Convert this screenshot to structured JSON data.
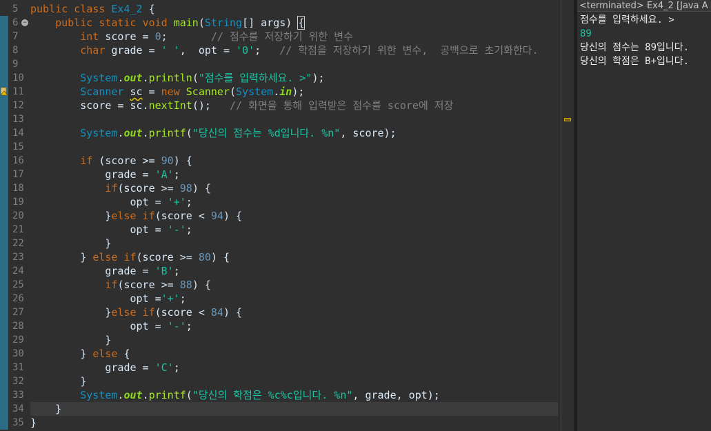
{
  "editor": {
    "lines": [
      {
        "n": "5",
        "segs": [
          [
            "kw",
            "public "
          ],
          [
            "kw",
            "class "
          ],
          [
            "cls",
            "Ex4_2"
          ],
          [
            "id",
            " {"
          ]
        ]
      },
      {
        "n": "6",
        "fold": true,
        "segs": [
          [
            "id",
            "    "
          ],
          [
            "kw",
            "public "
          ],
          [
            "kw",
            "static "
          ],
          [
            "kw",
            "void "
          ],
          [
            "mth",
            "main"
          ],
          [
            "id",
            "("
          ],
          [
            "cls",
            "String"
          ],
          [
            "id",
            "[] "
          ],
          [
            "id",
            "args) "
          ],
          [
            "brk",
            "{"
          ]
        ]
      },
      {
        "n": "7",
        "segs": [
          [
            "id",
            "        "
          ],
          [
            "kw",
            "int "
          ],
          [
            "id",
            "score = "
          ],
          [
            "num",
            "0"
          ],
          [
            "id",
            ";       "
          ],
          [
            "cmt",
            "// 점수를 저장하기 위한 변수"
          ]
        ]
      },
      {
        "n": "8",
        "segs": [
          [
            "id",
            "        "
          ],
          [
            "kw",
            "char "
          ],
          [
            "id",
            "grade = "
          ],
          [
            "str",
            "' '"
          ],
          [
            "id",
            ",  opt = "
          ],
          [
            "str",
            "'0'"
          ],
          [
            "id",
            ";   "
          ],
          [
            "cmt",
            "// 학점을 저장하기 위한 변수,  공백으로 초기화한다."
          ]
        ]
      },
      {
        "n": "9",
        "segs": []
      },
      {
        "n": "10",
        "segs": [
          [
            "id",
            "        "
          ],
          [
            "cls",
            "System"
          ],
          [
            "id",
            "."
          ],
          [
            "st-fld",
            "out"
          ],
          [
            "id",
            "."
          ],
          [
            "mth",
            "println"
          ],
          [
            "id",
            "("
          ],
          [
            "str",
            "\"점수를 입력하세요. >\""
          ],
          [
            "id",
            ");"
          ]
        ]
      },
      {
        "n": "11",
        "warn": true,
        "segs": [
          [
            "id",
            "        "
          ],
          [
            "cls",
            "Scanner "
          ],
          [
            "squig",
            "sc"
          ],
          [
            "id",
            " = "
          ],
          [
            "kw",
            "new "
          ],
          [
            "mth",
            "Scanner"
          ],
          [
            "id",
            "("
          ],
          [
            "cls",
            "System"
          ],
          [
            "id",
            "."
          ],
          [
            "st-fld",
            "in"
          ],
          [
            "id",
            ");"
          ]
        ]
      },
      {
        "n": "12",
        "segs": [
          [
            "id",
            "        "
          ],
          [
            "id",
            "score = sc."
          ],
          [
            "mth",
            "nextInt"
          ],
          [
            "id",
            "();   "
          ],
          [
            "cmt",
            "// 화면을 통해 입력받은 점수를 score에 저장"
          ]
        ]
      },
      {
        "n": "13",
        "segs": []
      },
      {
        "n": "14",
        "segs": [
          [
            "id",
            "        "
          ],
          [
            "cls",
            "System"
          ],
          [
            "id",
            "."
          ],
          [
            "st-fld",
            "out"
          ],
          [
            "id",
            "."
          ],
          [
            "mth",
            "printf"
          ],
          [
            "id",
            "("
          ],
          [
            "str",
            "\"당신의 점수는 %d입니다. %n\""
          ],
          [
            "id",
            ", score);"
          ]
        ]
      },
      {
        "n": "15",
        "segs": []
      },
      {
        "n": "16",
        "segs": [
          [
            "id",
            "        "
          ],
          [
            "kw",
            "if "
          ],
          [
            "id",
            "(score >= "
          ],
          [
            "num",
            "90"
          ],
          [
            "id",
            ") {"
          ]
        ]
      },
      {
        "n": "17",
        "segs": [
          [
            "id",
            "            "
          ],
          [
            "id",
            "grade = "
          ],
          [
            "str",
            "'A'"
          ],
          [
            "id",
            ";"
          ]
        ]
      },
      {
        "n": "18",
        "segs": [
          [
            "id",
            "            "
          ],
          [
            "kw",
            "if"
          ],
          [
            "id",
            "(score >= "
          ],
          [
            "num",
            "98"
          ],
          [
            "id",
            ") {"
          ]
        ]
      },
      {
        "n": "19",
        "segs": [
          [
            "id",
            "                "
          ],
          [
            "id",
            "opt = "
          ],
          [
            "str",
            "'+'"
          ],
          [
            "id",
            ";"
          ]
        ]
      },
      {
        "n": "20",
        "segs": [
          [
            "id",
            "            "
          ],
          [
            "id",
            "}"
          ],
          [
            "kw",
            "else if"
          ],
          [
            "id",
            "(score < "
          ],
          [
            "num",
            "94"
          ],
          [
            "id",
            ") {"
          ]
        ]
      },
      {
        "n": "21",
        "segs": [
          [
            "id",
            "                "
          ],
          [
            "id",
            "opt = "
          ],
          [
            "str",
            "'-'"
          ],
          [
            "id",
            ";"
          ]
        ]
      },
      {
        "n": "22",
        "segs": [
          [
            "id",
            "            "
          ],
          [
            "id",
            "}"
          ]
        ]
      },
      {
        "n": "23",
        "segs": [
          [
            "id",
            "        "
          ],
          [
            "id",
            "} "
          ],
          [
            "kw",
            "else if"
          ],
          [
            "id",
            "(score >= "
          ],
          [
            "num",
            "80"
          ],
          [
            "id",
            ") {"
          ]
        ]
      },
      {
        "n": "24",
        "segs": [
          [
            "id",
            "            "
          ],
          [
            "id",
            "grade = "
          ],
          [
            "str",
            "'B'"
          ],
          [
            "id",
            ";"
          ]
        ]
      },
      {
        "n": "25",
        "segs": [
          [
            "id",
            "            "
          ],
          [
            "kw",
            "if"
          ],
          [
            "id",
            "(score >= "
          ],
          [
            "num",
            "88"
          ],
          [
            "id",
            ") {"
          ]
        ]
      },
      {
        "n": "26",
        "segs": [
          [
            "id",
            "                "
          ],
          [
            "id",
            "opt ="
          ],
          [
            "str",
            "'+'"
          ],
          [
            "id",
            ";"
          ]
        ]
      },
      {
        "n": "27",
        "segs": [
          [
            "id",
            "            "
          ],
          [
            "id",
            "}"
          ],
          [
            "kw",
            "else if"
          ],
          [
            "id",
            "(score < "
          ],
          [
            "num",
            "84"
          ],
          [
            "id",
            ") {"
          ]
        ]
      },
      {
        "n": "28",
        "segs": [
          [
            "id",
            "                "
          ],
          [
            "id",
            "opt = "
          ],
          [
            "str",
            "'-'"
          ],
          [
            "id",
            ";"
          ]
        ]
      },
      {
        "n": "29",
        "segs": [
          [
            "id",
            "            "
          ],
          [
            "id",
            "}"
          ]
        ]
      },
      {
        "n": "30",
        "segs": [
          [
            "id",
            "        "
          ],
          [
            "id",
            "} "
          ],
          [
            "kw",
            "else "
          ],
          [
            "id",
            "{"
          ]
        ]
      },
      {
        "n": "31",
        "segs": [
          [
            "id",
            "            "
          ],
          [
            "id",
            "grade = "
          ],
          [
            "str",
            "'C'"
          ],
          [
            "id",
            ";"
          ]
        ]
      },
      {
        "n": "32",
        "segs": [
          [
            "id",
            "        "
          ],
          [
            "id",
            "}"
          ]
        ]
      },
      {
        "n": "33",
        "segs": [
          [
            "id",
            "        "
          ],
          [
            "cls",
            "System"
          ],
          [
            "id",
            "."
          ],
          [
            "st-fld",
            "out"
          ],
          [
            "id",
            "."
          ],
          [
            "mth",
            "printf"
          ],
          [
            "id",
            "("
          ],
          [
            "str",
            "\"당신의 학점은 %c%c입니다. %n\""
          ],
          [
            "id",
            ", grade, opt);"
          ]
        ]
      },
      {
        "n": "34",
        "current": true,
        "segs": [
          [
            "id",
            "    "
          ],
          [
            "id",
            "}"
          ]
        ]
      },
      {
        "n": "35",
        "segs": [
          [
            "id",
            "}"
          ]
        ]
      }
    ]
  },
  "console": {
    "header": "<terminated> Ex4_2 [Java A",
    "lines": [
      {
        "text": "점수를 입력하세요. >",
        "kind": "out"
      },
      {
        "text": "89",
        "kind": "input"
      },
      {
        "text": "당신의 점수는 89입니다.",
        "kind": "out"
      },
      {
        "text": "당신의 학점은 B+입니다.",
        "kind": "out"
      }
    ]
  }
}
